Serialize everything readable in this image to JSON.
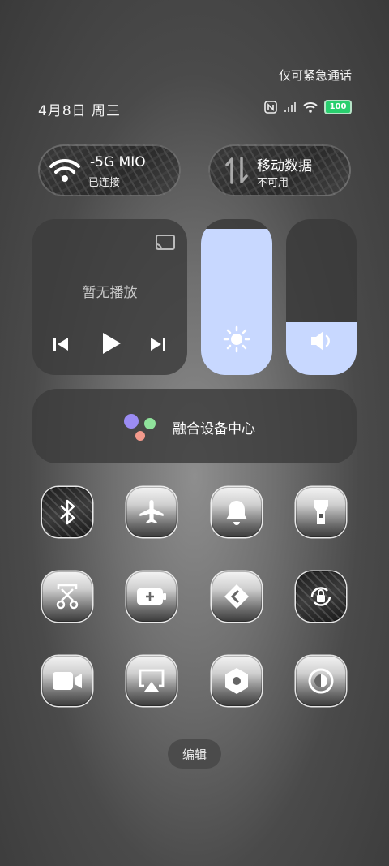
{
  "status_bar": {
    "emergency_text": "仅可紧急通话",
    "date": "4月8日 周三",
    "battery": "100"
  },
  "wifi_tile": {
    "name": "-5G MIO",
    "status": "已连接"
  },
  "mobile_data_tile": {
    "name": "移动数据",
    "status": "不可用"
  },
  "media": {
    "title": "暂无播放"
  },
  "brightness": {
    "level": 0.94
  },
  "volume": {
    "level": 0.34
  },
  "device_center": {
    "label": "融合设备中心"
  },
  "toggles": [
    {
      "icon": "bluetooth-icon"
    },
    {
      "icon": "airplane-icon"
    },
    {
      "icon": "bell-icon"
    },
    {
      "icon": "flashlight-icon"
    },
    {
      "icon": "screenshot-icon"
    },
    {
      "icon": "battery-saver-icon"
    },
    {
      "icon": "cast-icon"
    },
    {
      "icon": "rotation-lock-icon"
    },
    {
      "icon": "video-icon"
    },
    {
      "icon": "screen-mirror-icon"
    },
    {
      "icon": "settings-icon"
    },
    {
      "icon": "dark-mode-icon"
    }
  ],
  "edit_button": {
    "label": "编辑"
  },
  "colors": {
    "slider_fill": "#c8d8ff",
    "battery_green": "#29cf6e"
  }
}
